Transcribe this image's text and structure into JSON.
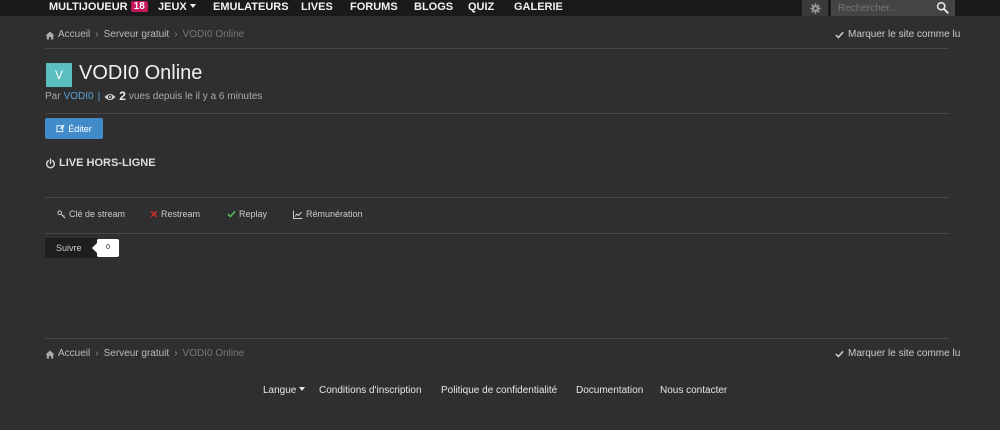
{
  "nav": {
    "items": [
      {
        "label": "MULTIJOUEUR",
        "badge": "18"
      },
      {
        "label": "JEUX"
      },
      {
        "label": "EMULATEURS"
      },
      {
        "label": "LIVES"
      },
      {
        "label": "FORUMS"
      },
      {
        "label": "BLOGS"
      },
      {
        "label": "QUIZ"
      },
      {
        "label": "GALERIE"
      }
    ],
    "search_placeholder": "Rechercher...",
    "icons": [
      "gear-icon",
      "search-icon",
      "caret-down-icon"
    ]
  },
  "breadcrumb": {
    "items": [
      "Accueil",
      "Serveur gratuit",
      "VODI0 Online"
    ],
    "mark_read": "Marquer le site comme lu"
  },
  "page": {
    "avatar_letter": "V",
    "avatar_color": "#5cbfbf",
    "title": "VODI0 Online",
    "by_label": "Par",
    "author": "VODI0",
    "separator": "|",
    "views_count": "2",
    "views_text": "vues depuis le il y a 6 minutes"
  },
  "actions": {
    "edit_label": "Éditer",
    "edit_color": "#428bca"
  },
  "live": {
    "status": "LIVE HORS-LIGNE"
  },
  "tabs": [
    {
      "label": "Clé de stream",
      "icon": "key-icon"
    },
    {
      "label": "Restream",
      "icon": "x-icon",
      "color": "#c9302c"
    },
    {
      "label": "Replay",
      "icon": "check-icon",
      "color": "#5cb85c"
    },
    {
      "label": "Rémunération",
      "icon": "line-chart-icon"
    }
  ],
  "follow": {
    "label": "Suivre",
    "count": "0"
  },
  "footer": {
    "links": [
      "Langue",
      "Conditions d'inscription",
      "Politique de confidentialité",
      "Documentation",
      "Nous contacter"
    ]
  }
}
